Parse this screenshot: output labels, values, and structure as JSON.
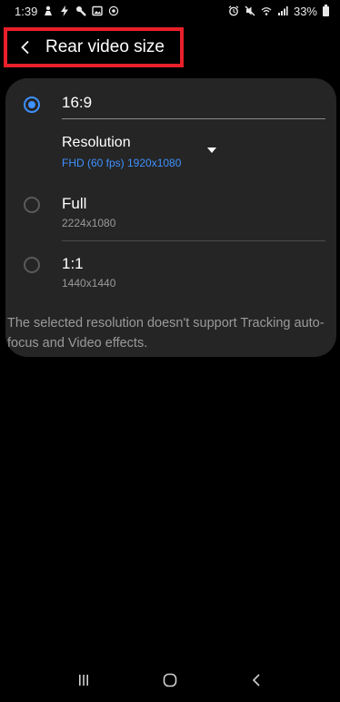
{
  "status_bar": {
    "time": "1:39",
    "battery": "33%",
    "left_icons": [
      "person-icon",
      "bolt-icon",
      "wrench-icon",
      "image-icon",
      "circle-icon"
    ],
    "right_icons": [
      "alarm-icon",
      "mute-icon",
      "wifi-icon",
      "signal-icon",
      "battery-icon"
    ]
  },
  "header": {
    "title": "Rear video size",
    "highlight_color": "#e8202a"
  },
  "options": [
    {
      "title": "16:9",
      "selected": true,
      "resolution_label": "Resolution",
      "resolution_value": "FHD (60 fps) 1920x1080"
    },
    {
      "title": "Full",
      "subtitle": "2224x1080",
      "selected": false
    },
    {
      "title": "1:1",
      "subtitle": "1440x1440",
      "selected": false
    }
  ],
  "note": "The selected resolution doesn't support Tracking auto-focus and Video effects.",
  "colors": {
    "accent": "#3e91ff",
    "card_bg": "#252525",
    "background": "#000000"
  },
  "nav_bar": {
    "buttons": [
      "recent-apps",
      "home",
      "back"
    ]
  }
}
